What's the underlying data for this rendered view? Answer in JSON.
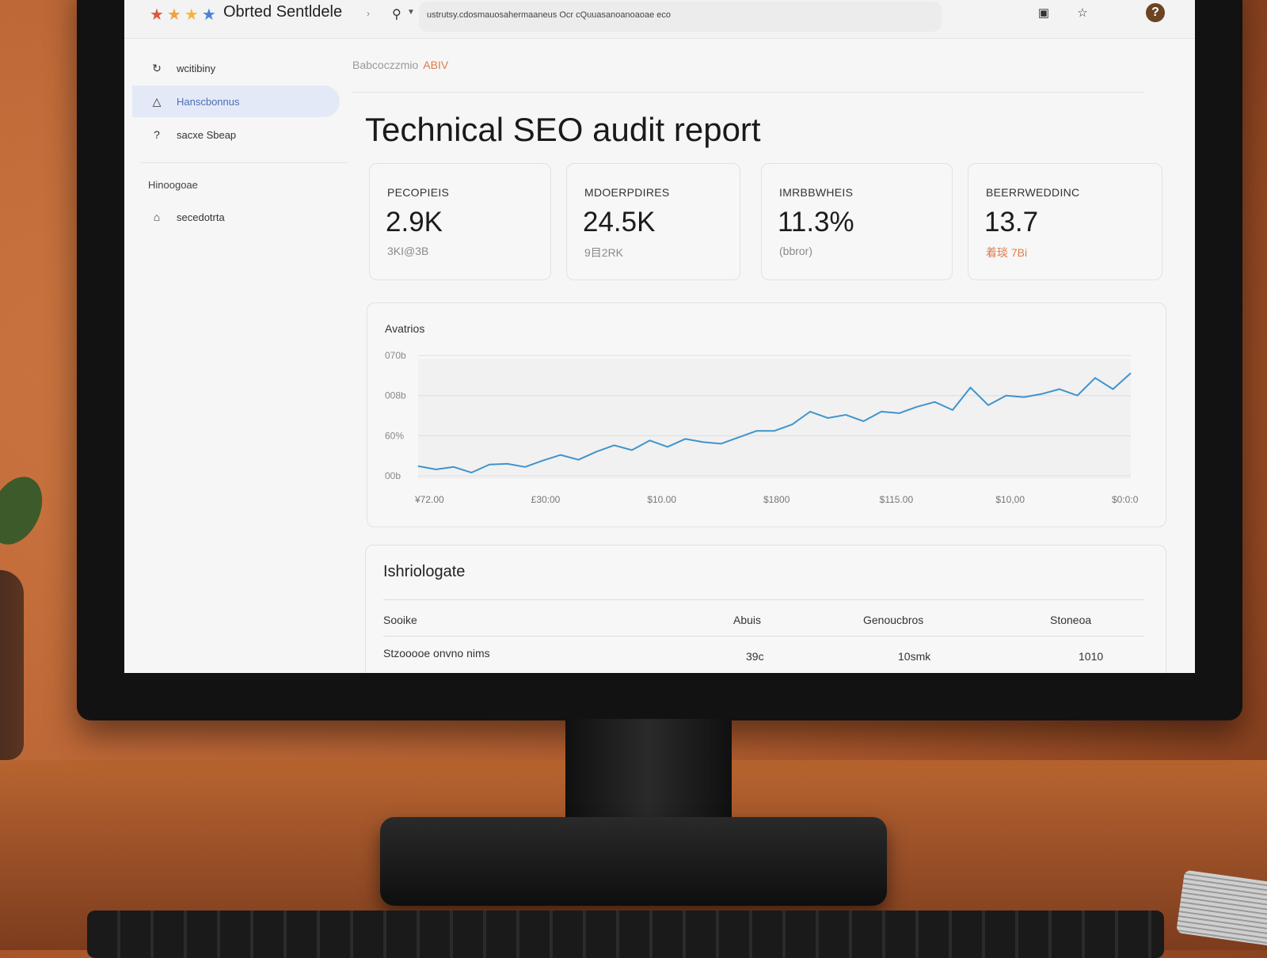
{
  "app": {
    "title": "Obrted Sentldele",
    "url": "ustrutsy.cdosmauosahermaaneus Ocr cQuuasanoanoaoae eco"
  },
  "sidebar": {
    "items": [
      {
        "label": "wcitibiny",
        "icon": "refresh-icon"
      },
      {
        "label": "Hanscbonnus",
        "icon": "triangle-icon"
      },
      {
        "label": "sacxe Sbeap",
        "icon": "question-icon"
      }
    ],
    "section_heading": "Hinoogoae",
    "section_items": [
      {
        "label": "secedotrta",
        "icon": "home-icon"
      }
    ]
  },
  "breadcrumb": {
    "text": "Babcoczzmio",
    "accent": "ABIV"
  },
  "page": {
    "title": "Technical SEO audit report"
  },
  "cards": [
    {
      "label": "PECOPIEIS",
      "value": "2.9K",
      "sub": "3KI@3B"
    },
    {
      "label": "MDOERPDIRES",
      "value": "24.5K",
      "sub": "9目2RK"
    },
    {
      "label": "IMRBBWHEIS",
      "value": "11.3%",
      "sub": "(bbror)"
    },
    {
      "label": "BEERRWEDDINC",
      "value": "13.7",
      "sub": "着琰 7Bi",
      "warn": true
    }
  ],
  "chart_data": {
    "type": "line",
    "title": "Avatrios",
    "y_tick_labels": [
      "070b",
      "008b",
      "60%",
      "00b"
    ],
    "x_tick_labels": [
      "¥72.00",
      "£30:00",
      "$10.00",
      "$1800",
      "$115.00",
      "$10,00",
      "$0:0:0"
    ],
    "values": [
      3,
      1,
      2.5,
      -1,
      4,
      4.5,
      2.5,
      6.5,
      10,
      7,
      12,
      16,
      13,
      19,
      15,
      20,
      18,
      17,
      21,
      25,
      25,
      29,
      37,
      33,
      35,
      31,
      37,
      36,
      40,
      43,
      38,
      52,
      41,
      47,
      46,
      48,
      51,
      47,
      58,
      51,
      61
    ],
    "ylim": [
      -5,
      70
    ],
    "color": "#3f94cc",
    "grid": true
  },
  "table": {
    "title": "Ishriologate",
    "columns": [
      "Sooike",
      "Abuis",
      "Genoucbros",
      "Stoneoa"
    ],
    "rows": [
      [
        "Stzooooe onvno nims",
        "39c",
        "10smk",
        "1010"
      ]
    ]
  },
  "colors": {
    "accent": "#e07b4a",
    "active_bg": "#e3e9f6",
    "active_text": "#4a6fb5",
    "help_bg": "#6b4423"
  }
}
